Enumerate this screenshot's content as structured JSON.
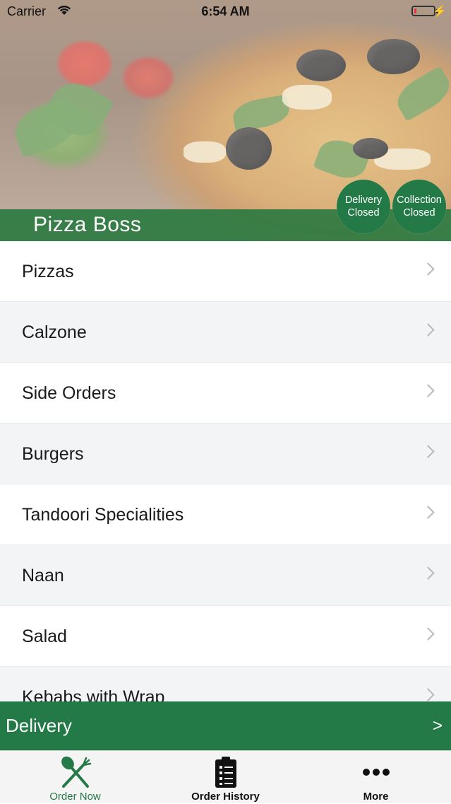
{
  "status_bar": {
    "carrier": "Carrier",
    "time": "6:54 AM",
    "battery_level_fraction": 0.1
  },
  "header": {
    "restaurant_name": "Pizza Boss",
    "badges": [
      {
        "line1": "Delivery",
        "line2": "Closed"
      },
      {
        "line1": "Collection",
        "line2": "Closed"
      }
    ]
  },
  "menu": {
    "items": [
      {
        "label": "Pizzas"
      },
      {
        "label": "Calzone"
      },
      {
        "label": "Side Orders"
      },
      {
        "label": "Burgers"
      },
      {
        "label": "Tandoori Specialities"
      },
      {
        "label": "Naan"
      },
      {
        "label": "Salad"
      },
      {
        "label": "Kebabs with Wrap"
      }
    ]
  },
  "delivery_bar": {
    "label": "Delivery",
    "arrow": ">"
  },
  "tab_bar": {
    "tabs": [
      {
        "label": "Order Now",
        "icon": "fork-knife-icon",
        "active": true
      },
      {
        "label": "Order History",
        "icon": "clipboard-list-icon",
        "active": false
      },
      {
        "label": "More",
        "icon": "more-dots-icon",
        "active": false
      }
    ]
  },
  "colors": {
    "brand_green": "#237a47",
    "chevron_gray": "#b9b9b9",
    "row_alt": "#f3f4f6"
  }
}
